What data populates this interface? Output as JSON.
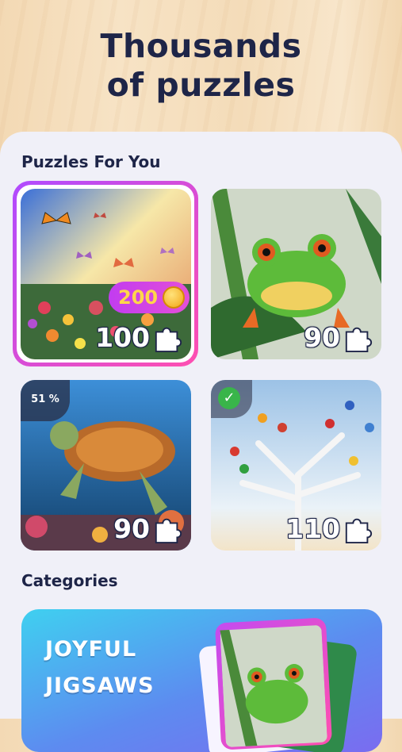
{
  "header": {
    "title_line1": "Thousands",
    "title_line2": "of puzzles"
  },
  "sections": {
    "for_you": "Puzzles For You",
    "categories": "Categories"
  },
  "puzzles": [
    {
      "subject": "butterflies",
      "pieces": "100",
      "reward": "200",
      "selected": true
    },
    {
      "subject": "frog",
      "pieces": "90"
    },
    {
      "subject": "sea turtle",
      "pieces": "90",
      "progress": "51 %"
    },
    {
      "subject": "birds on tree",
      "pieces": "110",
      "completed": true
    }
  ],
  "category_banner": {
    "line1": "JOYFUL",
    "line2": "JIGSAWS"
  },
  "colors": {
    "headline": "#1e2548",
    "selection_gradient": [
      "#b04bff",
      "#ff4fb0"
    ],
    "coin": "#f2a516"
  }
}
